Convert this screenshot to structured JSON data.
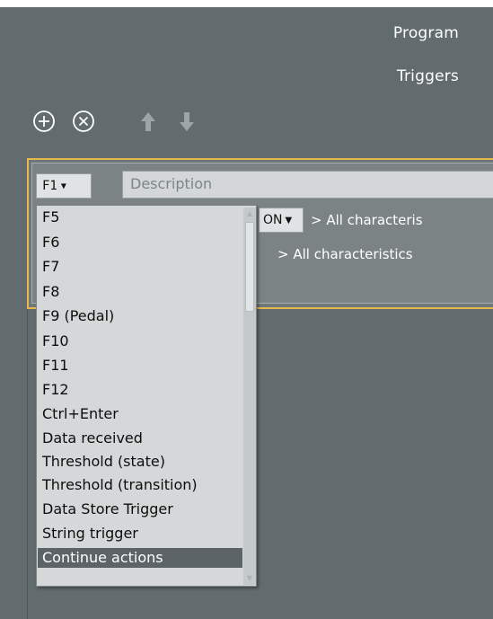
{
  "menu": {
    "program_label": "Program",
    "triggers_label": "Triggers"
  },
  "toolbar": {
    "icons": [
      "add-circle-icon",
      "remove-circle-icon",
      "arrow-up-icon",
      "arrow-down-icon"
    ]
  },
  "trigger": {
    "key_value": "F1",
    "description_placeholder": "Description",
    "state_value": "ON",
    "crumb_1": "> All characteris",
    "crumb_2": "> All characteristics"
  },
  "dropdown": {
    "options": [
      "F5",
      "F6",
      "F7",
      "F8",
      "F9 (Pedal)",
      "F10",
      "F11",
      "F12",
      "Ctrl+Enter",
      "Data received",
      "Threshold (state)",
      "Threshold (transition)",
      "Data Store Trigger",
      "String trigger",
      "Continue actions"
    ],
    "selected": "Continue actions"
  },
  "colors": {
    "background": "#626b6d",
    "accent_border": "#e6b84b",
    "selected_option": "#5d6467"
  }
}
